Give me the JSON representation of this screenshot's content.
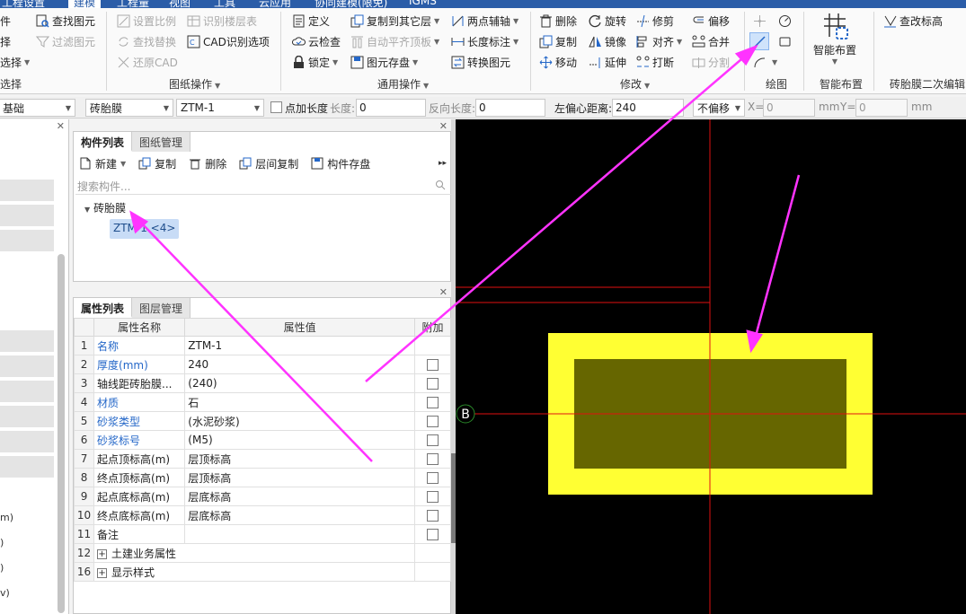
{
  "menubar": {
    "items": [
      "工程设置",
      "建模",
      "工程量",
      "视图",
      "工具",
      "云应用",
      "协同建模(限免)",
      "IGMS"
    ],
    "active": "建模"
  },
  "ribbon": {
    "col0": {
      "btn1": "件",
      "btn2": "择",
      "btn3": "选择",
      "label": "选择"
    },
    "col1": {
      "find_elem": "查找图元",
      "filter_elem": "过滤图元"
    },
    "drawing_ops": {
      "set_scale": "设置比例",
      "find_replace": "查找替换",
      "restore_cad": "还原CAD",
      "identify_floor_table": "识别楼层表",
      "cad_identify_options": "CAD识别选项",
      "label": "图纸操作"
    },
    "common_ops": {
      "define": "定义",
      "cloud_check": "云检查",
      "lock": "锁定",
      "copy_to_layer": "复制到其它层",
      "auto_flush_top": "自动平齐顶板",
      "elem_save": "图元存盘",
      "two_point_axis": "两点辅轴",
      "length_dim": "长度标注",
      "convert_elem": "转换图元",
      "label": "通用操作"
    },
    "modify": {
      "delete": "删除",
      "copy": "复制",
      "move": "移动",
      "rotate": "旋转",
      "mirror": "镜像",
      "extend": "延伸",
      "trim": "修剪",
      "align": "对齐",
      "break": "打断",
      "offset": "偏移",
      "merge": "合并",
      "split": "分割",
      "label": "修改"
    },
    "draw": {
      "label": "绘图"
    },
    "smart": {
      "smart_layout": "智能布置",
      "label": "智能布置"
    },
    "secondary": {
      "check_elevation": "查改标高",
      "label": "砖胎膜二次编辑"
    }
  },
  "optbar": {
    "floor_select": "基础",
    "type_select": "砖胎膜",
    "name_select": "ZTM-1",
    "point_length_label": "点加长度",
    "length_label": "长度:",
    "length_value": "0",
    "reverse_length_label": "反向长度:",
    "reverse_length_value": "0",
    "left_offset_label": "左偏心距离:",
    "left_offset_value": "240",
    "offset_select": "不偏移",
    "x_label": "X=",
    "x_value": "0",
    "x_unit": "mm",
    "y_label": "Y=",
    "y_value": "0",
    "y_unit": "mm"
  },
  "leftpanel": {
    "labels": [
      "m)",
      ")",
      ")",
      "v)"
    ]
  },
  "component_panel": {
    "tabs": [
      "构件列表",
      "图纸管理"
    ],
    "toolbar": {
      "new": "新建",
      "copy": "复制",
      "delete": "删除",
      "layer_copy": "层间复制",
      "save": "构件存盘"
    },
    "search_placeholder": "搜索构件...",
    "tree_root": "砖胎膜",
    "tree_child": "ZTM-1 <4>"
  },
  "property_panel": {
    "tabs": [
      "属性列表",
      "图层管理"
    ],
    "headers": {
      "name": "属性名称",
      "value": "属性值",
      "add": "附加"
    },
    "rows": [
      {
        "num": "1",
        "name": "名称",
        "value": "ZTM-1",
        "blue": true,
        "checkbox": false
      },
      {
        "num": "2",
        "name": "厚度(mm)",
        "value": "240",
        "blue": true,
        "checkbox": true
      },
      {
        "num": "3",
        "name": "轴线距砖胎膜...",
        "value": "(240)",
        "blue": false,
        "checkbox": true
      },
      {
        "num": "4",
        "name": "材质",
        "value": "石",
        "blue": true,
        "checkbox": true
      },
      {
        "num": "5",
        "name": "砂浆类型",
        "value": "(水泥砂浆)",
        "blue": true,
        "checkbox": true
      },
      {
        "num": "6",
        "name": "砂浆标号",
        "value": "(M5)",
        "blue": true,
        "checkbox": true
      },
      {
        "num": "7",
        "name": "起点顶标高(m)",
        "value": "层顶标高",
        "blue": false,
        "checkbox": true
      },
      {
        "num": "8",
        "name": "终点顶标高(m)",
        "value": "层顶标高",
        "blue": false,
        "checkbox": true
      },
      {
        "num": "9",
        "name": "起点底标高(m)",
        "value": "层底标高",
        "blue": false,
        "checkbox": true
      },
      {
        "num": "10",
        "name": "终点底标高(m)",
        "value": "层底标高",
        "blue": false,
        "checkbox": true
      },
      {
        "num": "11",
        "name": "备注",
        "value": "",
        "blue": false,
        "checkbox": true
      },
      {
        "num": "12",
        "name": "土建业务属性",
        "value": "",
        "blue": false,
        "checkbox": false,
        "expand": true
      },
      {
        "num": "16",
        "name": "显示样式",
        "value": "",
        "blue": false,
        "checkbox": false,
        "expand": true
      }
    ]
  },
  "canvas": {
    "axis_label": "B",
    "colors": {
      "background": "#000000",
      "frame": "#ffff33",
      "inner": "#666600",
      "axis": "#e01010",
      "arrow": "#ff33ff"
    }
  }
}
